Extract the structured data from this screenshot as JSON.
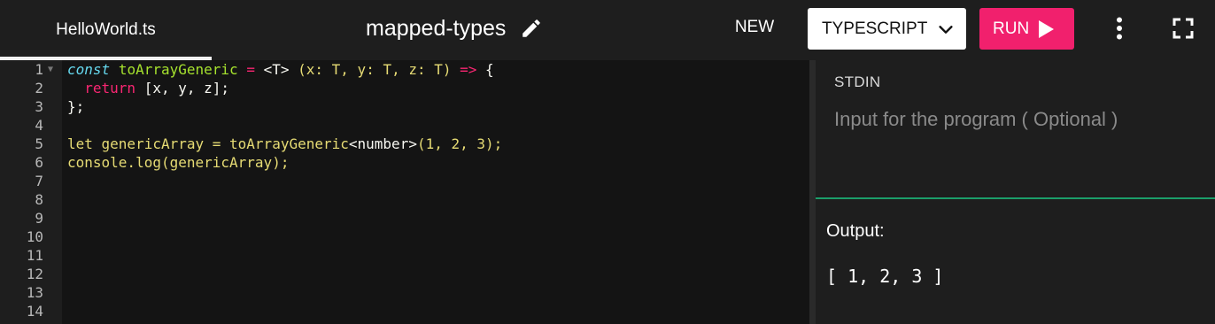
{
  "header": {
    "tab_label": "HelloWorld.ts",
    "title": "mapped-types",
    "new_label": "NEW",
    "language": "TYPESCRIPT",
    "run_label": "RUN"
  },
  "editor": {
    "line_numbers": [
      "1",
      "2",
      "3",
      "4",
      "5",
      "6",
      "7",
      "8",
      "9",
      "10",
      "11",
      "12",
      "13",
      "14"
    ],
    "lines": [
      "const toArrayGeneric = <T> (x: T, y: T, z: T) => {",
      "  return [x, y, z];",
      "};",
      "",
      "let genericArray = toArrayGeneric<number>(1, 2, 3);",
      "console.log(genericArray);"
    ]
  },
  "stdin": {
    "label": "STDIN",
    "placeholder": "Input for the program ( Optional )"
  },
  "output": {
    "label": "Output:",
    "text": "[ 1, 2, 3 ]"
  },
  "colors": {
    "run_button": "#f1206d",
    "divider": "#1b9e6a",
    "background": "#1e1e1e",
    "editor_background": "#141414"
  },
  "icons": {
    "edit": "pencil-icon",
    "language_dropdown": "chevron-down-icon",
    "run": "play-icon",
    "more": "more-vertical-icon",
    "fullscreen": "fullscreen-icon"
  }
}
